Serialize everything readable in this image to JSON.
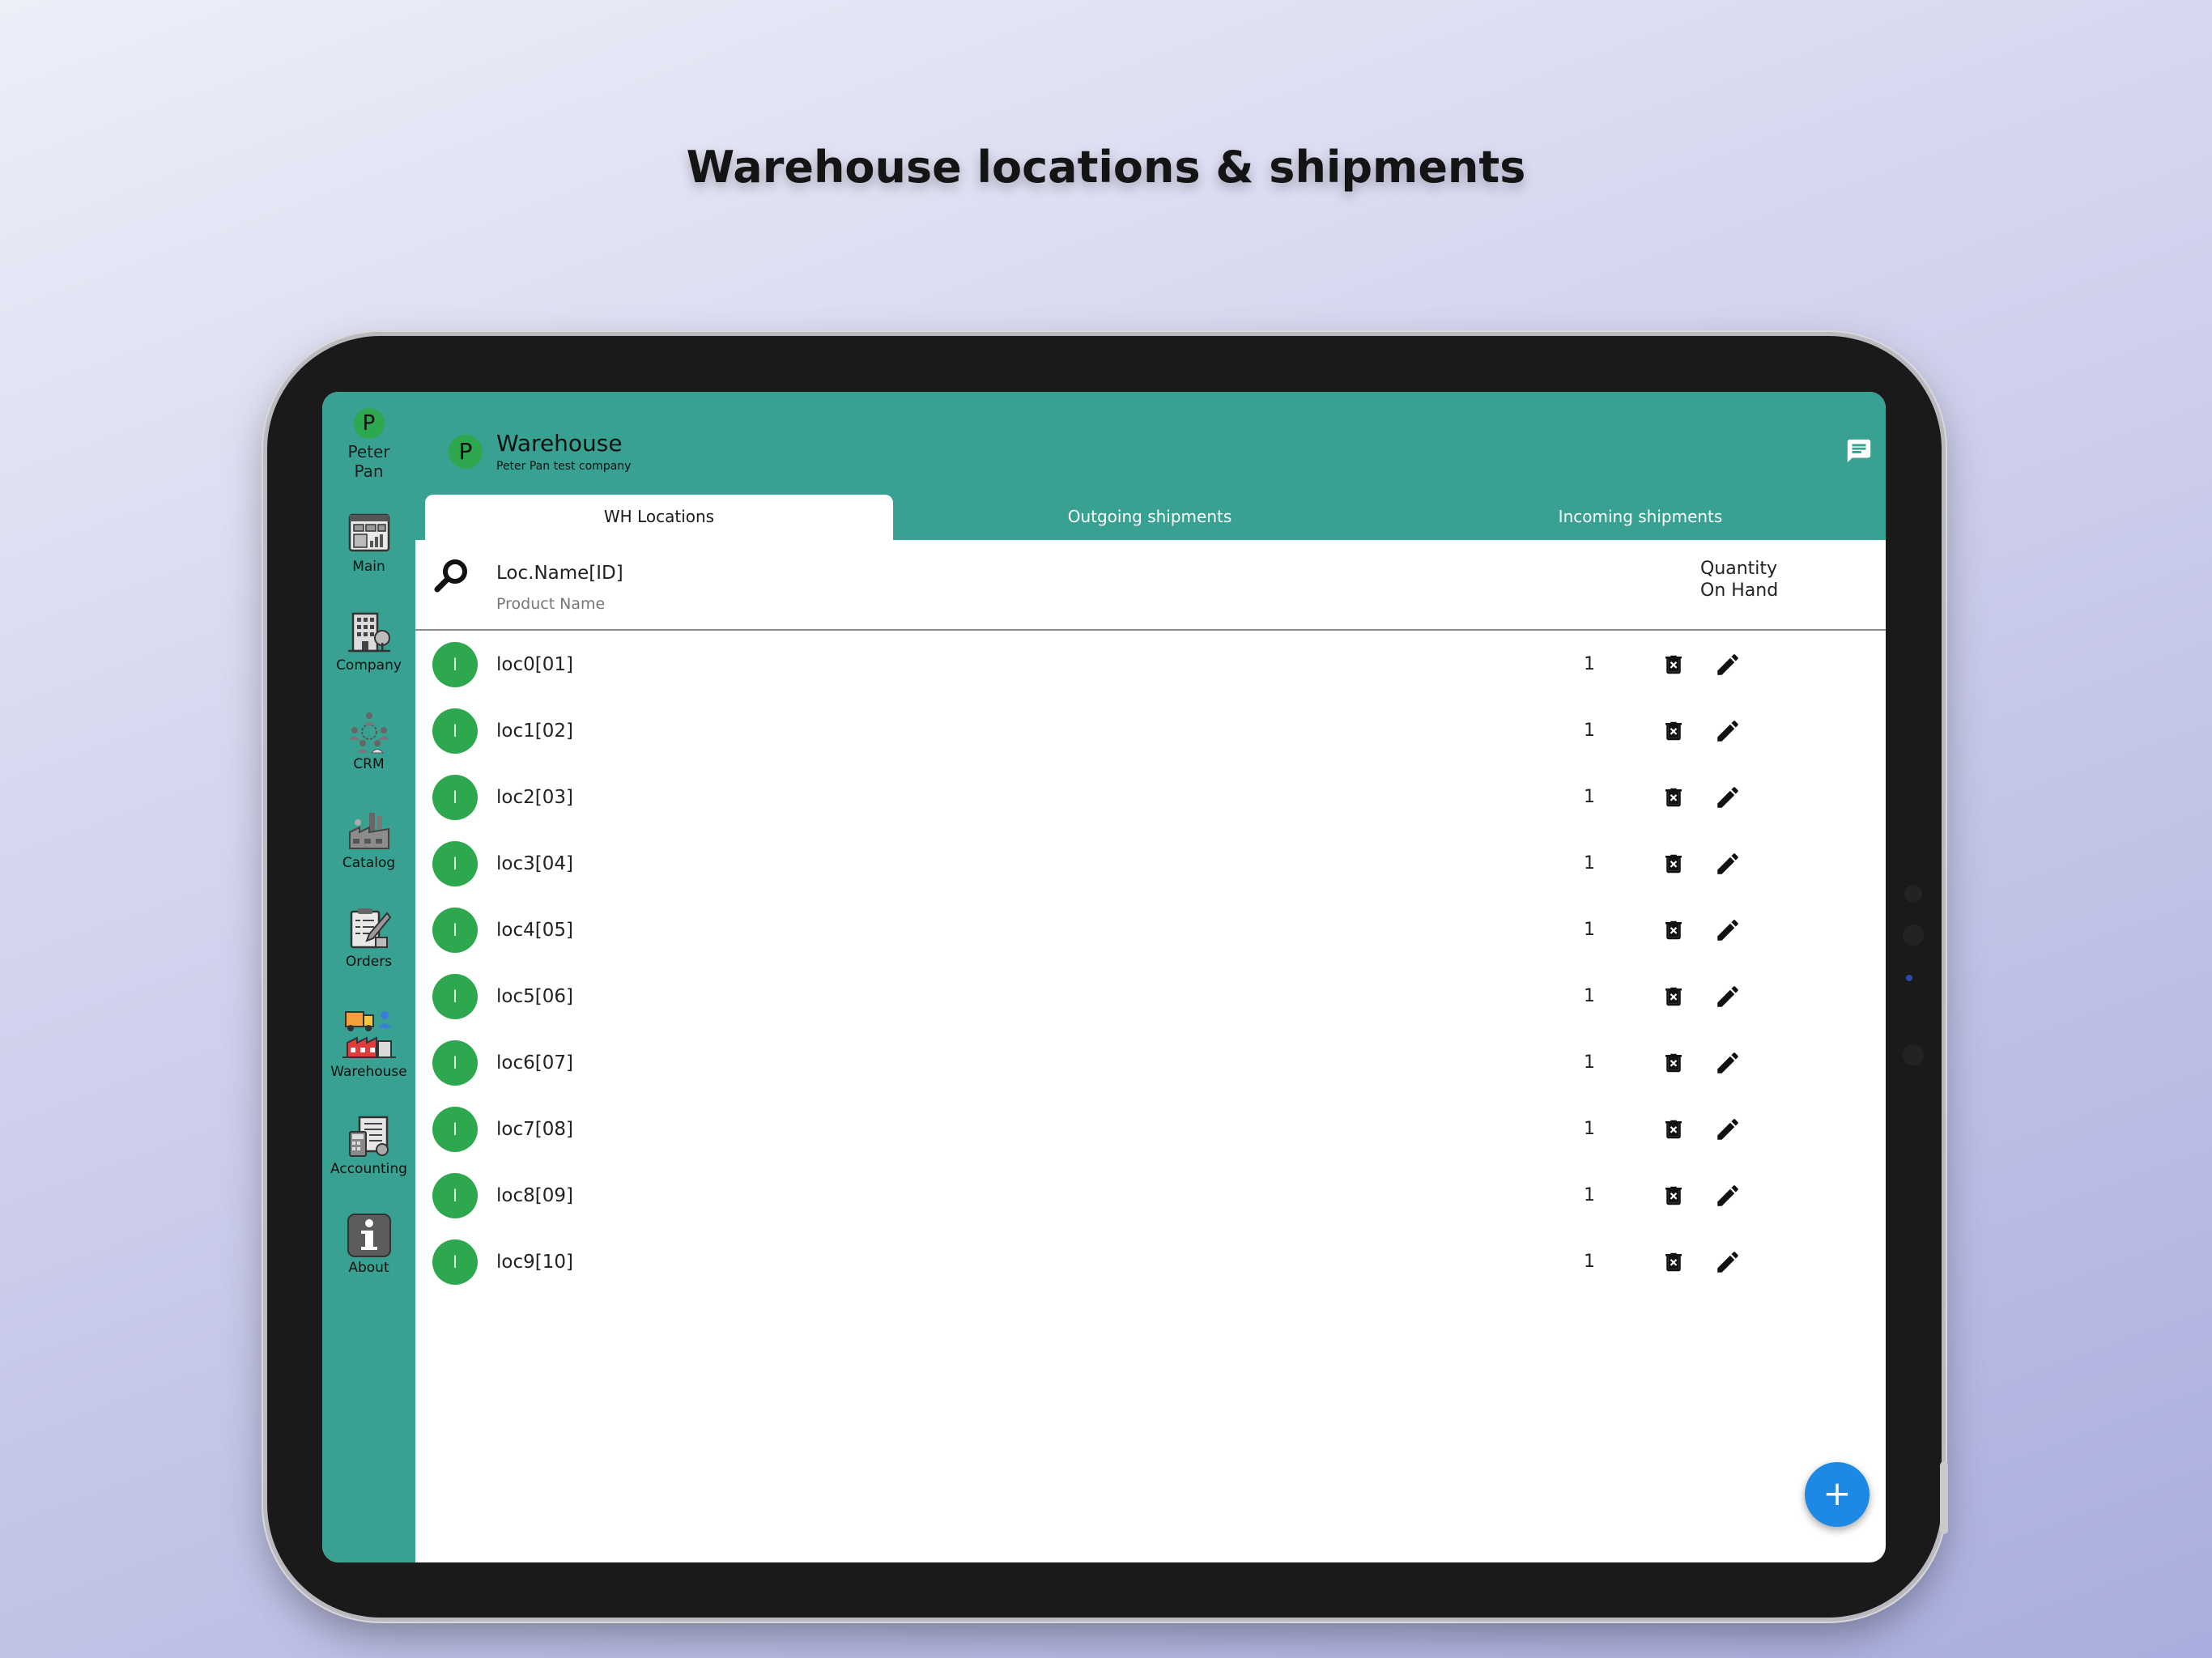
{
  "banner": {
    "title": "Warehouse locations & shipments"
  },
  "sidebar": {
    "user": {
      "initial": "P",
      "name_line1": "Peter",
      "name_line2": "Pan"
    },
    "items": [
      {
        "label": "Main",
        "icon": "dashboard-icon"
      },
      {
        "label": "Company",
        "icon": "building-icon"
      },
      {
        "label": "CRM",
        "icon": "people-network-icon"
      },
      {
        "label": "Catalog",
        "icon": "factory-icon"
      },
      {
        "label": "Orders",
        "icon": "order-form-icon"
      },
      {
        "label": "Warehouse",
        "icon": "warehouse-truck-icon"
      },
      {
        "label": "Accounting",
        "icon": "calculator-document-icon"
      },
      {
        "label": "About",
        "icon": "info-icon"
      }
    ]
  },
  "header": {
    "initial": "P",
    "title": "Warehouse",
    "subtitle": "Peter Pan test company",
    "chat_icon": "chat-icon"
  },
  "tabs": [
    {
      "label": "WH Locations",
      "active": true
    },
    {
      "label": "Outgoing shipments",
      "active": false
    },
    {
      "label": "Incoming shipments",
      "active": false
    }
  ],
  "list_header": {
    "search_icon": "search-icon",
    "name_col": "Loc.Name[ID]",
    "product_col": "Product Name",
    "qty_line1": "Quantity",
    "qty_line2": "On Hand"
  },
  "rows": [
    {
      "initial": "l",
      "name": "loc0[01]",
      "qty": "1"
    },
    {
      "initial": "l",
      "name": "loc1[02]",
      "qty": "1"
    },
    {
      "initial": "l",
      "name": "loc2[03]",
      "qty": "1"
    },
    {
      "initial": "l",
      "name": "loc3[04]",
      "qty": "1"
    },
    {
      "initial": "l",
      "name": "loc4[05]",
      "qty": "1"
    },
    {
      "initial": "l",
      "name": "loc5[06]",
      "qty": "1"
    },
    {
      "initial": "l",
      "name": "loc6[07]",
      "qty": "1"
    },
    {
      "initial": "l",
      "name": "loc7[08]",
      "qty": "1"
    },
    {
      "initial": "l",
      "name": "loc8[09]",
      "qty": "1"
    },
    {
      "initial": "l",
      "name": "loc9[10]",
      "qty": "1"
    }
  ],
  "fab": {
    "label": "+"
  },
  "colors": {
    "teal": "#38a191",
    "avatar_green": "#2ea84e",
    "fab_blue": "#1e88e5"
  }
}
